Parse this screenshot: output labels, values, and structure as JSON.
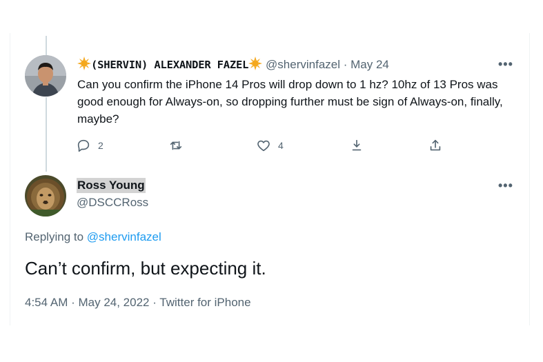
{
  "original_tweet": {
    "display_name": "(SHERVIN) ALEXANDER FAZEL",
    "handle": "@shervinfazel",
    "separator": "·",
    "date": "May 24",
    "more": "•••",
    "text": "Can you confirm the iPhone 14 Pros will drop down to 1 hz? 10hz of 13 Pros was good enough for Always-on, so dropping further must be sign of Always-on, finally, maybe?",
    "reply_count": "2",
    "like_count": "4",
    "icons": [
      "sun-emoji-icon",
      "reply-icon",
      "retweet-icon",
      "like-icon",
      "save-icon",
      "share-icon"
    ]
  },
  "reply_tweet": {
    "display_name": "Ross Young",
    "handle": "@DSCCRoss",
    "more": "•••",
    "replying_prefix": "Replying to ",
    "replying_handle": "@shervinfazel",
    "text": "Can’t confirm, but expecting it.",
    "time": "4:54 AM · May 24, 2022 · Twitter for iPhone"
  },
  "colors": {
    "text_primary": "#0f1419",
    "text_secondary": "#536471",
    "link": "#1d9bf0",
    "thread_line": "#cfd9de",
    "sun": "#f4a81d"
  }
}
